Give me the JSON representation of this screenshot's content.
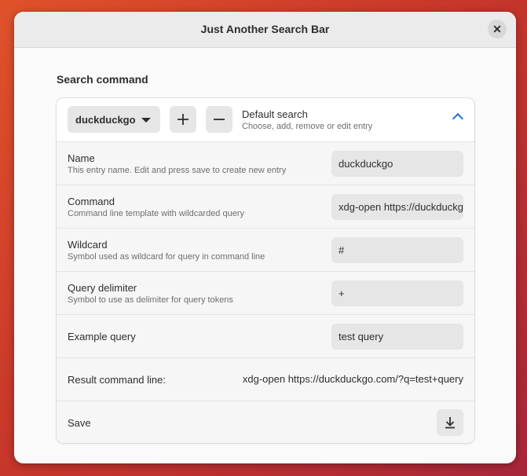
{
  "window": {
    "title": "Just Another Search Bar"
  },
  "section": {
    "title": "Search command"
  },
  "command_row": {
    "selected_engine": "duckduckgo",
    "title": "Default search",
    "subtitle": "Choose, add, remove or edit entry"
  },
  "fields": [
    {
      "label": "Name",
      "sublabel": "This entry name. Edit and press save to create new entry",
      "value": "duckduckgo"
    },
    {
      "label": "Command",
      "sublabel": "Command line template with wildcarded query",
      "value": "xdg-open https://duckduckgo.com/?q=#"
    },
    {
      "label": "Wildcard",
      "sublabel": "Symbol used as wildcard for query in command line",
      "value": "#"
    },
    {
      "label": "Query delimiter",
      "sublabel": "Symbol to use as delimiter for query tokens",
      "value": "+"
    },
    {
      "label": "Example query",
      "value": "test query"
    }
  ],
  "result": {
    "label": "Result command line:",
    "value": "xdg-open https://duckduckgo.com/?q=test+query"
  },
  "save": {
    "label": "Save"
  },
  "colors": {
    "accent": "#1c71d8",
    "background": "#d8402c"
  }
}
